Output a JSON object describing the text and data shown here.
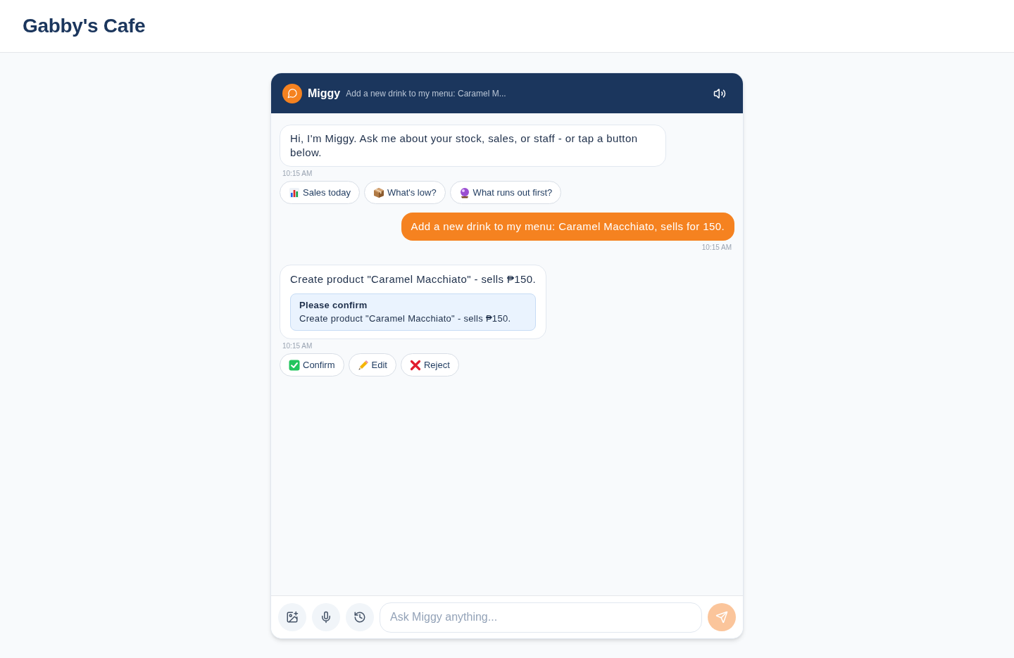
{
  "app": {
    "title": "Gabby's Cafe"
  },
  "chat": {
    "assistant_name": "Miggy",
    "subtitle": "Add a new drink to my menu: Caramel M...",
    "messages": [
      {
        "kind": "assistant",
        "text": "Hi, I'm Miggy. Ask me about your stock, sales, or staff - or tap a button below.",
        "time": "10:15 AM",
        "actions": [
          {
            "kind": "sales",
            "label": "Sales today"
          },
          {
            "kind": "stock",
            "label": "What's low?"
          },
          {
            "kind": "forecast",
            "label": "What runs out first?"
          }
        ]
      },
      {
        "kind": "user",
        "text": "Add a new drink to my menu: Caramel Macchiato, sells for 150.",
        "time": "10:15 AM"
      },
      {
        "kind": "assistant",
        "text": "Create product \"Caramel Macchiato\" - sells ₱150.",
        "confirm": {
          "title": "Please confirm",
          "text": "Create product \"Caramel Macchiato\" - sells ₱150."
        },
        "time": "10:15 AM",
        "actions": [
          {
            "kind": "confirm",
            "label": "Confirm"
          },
          {
            "kind": "edit",
            "label": "Edit"
          },
          {
            "kind": "reject",
            "label": "Reject"
          }
        ]
      }
    ],
    "composer": {
      "placeholder": "Ask Miggy anything...",
      "send_disabled": true
    }
  }
}
